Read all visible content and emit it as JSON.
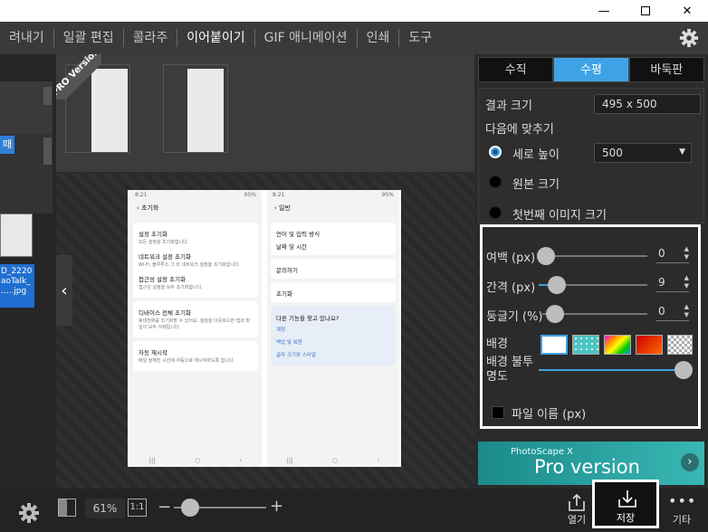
{
  "menu": {
    "items": [
      "려내기",
      "일괄 편집",
      "콜라주",
      "이어붙이기",
      "GIF 애니메이션",
      "인쇄",
      "도구"
    ],
    "active": "이어붙이기"
  },
  "left_strip": {
    "blue_tag": "때",
    "file_label": "D_2220 aoTalk_ .....jpg"
  },
  "pro_badge": "PRO Version",
  "preview": {
    "left": {
      "status_time": "8:21",
      "status_right": "95%",
      "title": "초기화",
      "items": [
        {
          "title": "설정 초기화",
          "sub": "모든 설정을 초기화합니다."
        },
        {
          "title": "네트워크 설정 초기화",
          "sub": "Wi-Fi, 블루투스 그 외 네트워크 설정을 초기화합니다."
        },
        {
          "title": "접근성 설정 초기화",
          "sub": "접근성 설정을 모두 초기화합니다."
        },
        {
          "title": "디바이스 전체 초기화",
          "sub": "휴대전화를 초기화할 수 있어요. 설정을 다운로드한 앱과 파일이 모두 삭제됩니다."
        },
        {
          "title": "자동 재시작",
          "sub": "매일 정해진 시간에 자동으로 재시작하도록 합니다."
        }
      ]
    },
    "right": {
      "status_time": "8:21",
      "status_right": "95%",
      "title": "일반",
      "items": [
        "언어 및 입력 방식",
        "날짜 및 시간",
        "문의하기",
        "초기화"
      ],
      "help_title": "다른 기능을 찾고 있나요?",
      "help_links": [
        "계정",
        "백업 및 복원",
        "글자 크기와 스타일"
      ]
    }
  },
  "panel": {
    "tabs": [
      "수직",
      "수평",
      "바둑판"
    ],
    "active_tab": "수평",
    "result_size_label": "결과 크기",
    "result_size_value": "495 x 500",
    "fit_label": "다음에 맞추기",
    "radio_options": [
      "세로 높이",
      "원본 크기",
      "첫번째 이미지 크기"
    ],
    "selected_radio": "세로 높이",
    "height_value": "500",
    "margin_label": "여백 (px)",
    "margin_value": "0",
    "spacing_label": "간격 (px)",
    "spacing_value": "9",
    "roundness_label": "둥글기 (%)",
    "roundness_value": "0",
    "background_label": "배경",
    "opacity_label": "배경 불투명도",
    "opacity_fraction": 1.0,
    "filename_label": "파일 이름 (px)",
    "filename_checked": false
  },
  "ad": {
    "small_text": "PhotoScape X",
    "big_text": "Pro version"
  },
  "bottom": {
    "zoom": "61%",
    "one_to_one": "1:1",
    "open_label": "열기",
    "save_label": "저장",
    "more_label": "기타"
  },
  "colors": {
    "accent": "#3ea3e6",
    "panel_bg": "#2b2b2b",
    "menu_bg": "#3a3a3a"
  }
}
